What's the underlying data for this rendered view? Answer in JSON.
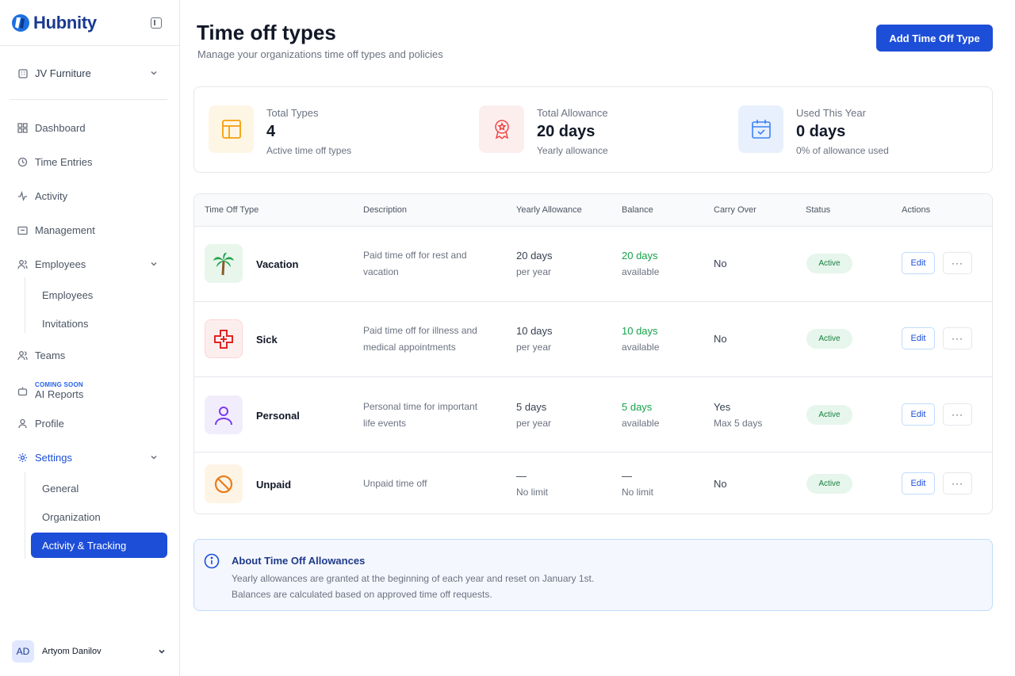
{
  "app": {
    "name": "Hubnity"
  },
  "sidebar": {
    "org": "JV Furniture",
    "items": [
      {
        "label": "Dashboard"
      },
      {
        "label": "Time Entries"
      },
      {
        "label": "Activity"
      },
      {
        "label": "Management"
      },
      {
        "label": "Employees",
        "children": [
          {
            "label": "Employees"
          },
          {
            "label": "Invitations"
          }
        ]
      },
      {
        "label": "Teams"
      },
      {
        "label": "AI Reports",
        "badge": "COMING SOON"
      },
      {
        "label": "Profile"
      },
      {
        "label": "Settings",
        "children": [
          {
            "label": "General"
          },
          {
            "label": "Organization"
          },
          {
            "label": "Activity & Tracking",
            "active": true
          }
        ]
      }
    ],
    "user": {
      "initials": "AD",
      "name": "Artyom Danilov"
    }
  },
  "header": {
    "title": "Time off types",
    "subtitle": "Manage your organizations time off types and policies",
    "add_button": "Add Time Off Type"
  },
  "stats": [
    {
      "label": "Total Types",
      "value": "4",
      "desc": "Active time off types",
      "icon": "layout-icon",
      "color": "#f59e0b"
    },
    {
      "label": "Total Allowance",
      "value": "20 days",
      "desc": "Yearly allowance",
      "icon": "award-icon",
      "color": "#ef4444"
    },
    {
      "label": "Used This Year",
      "value": "0 days",
      "desc": "0% of allowance used",
      "icon": "calendar-check-icon",
      "color": "#3b82f6"
    }
  ],
  "table": {
    "columns": [
      "Time Off Type",
      "Description",
      "Yearly Allowance",
      "Balance",
      "Carry Over",
      "Status",
      "Actions"
    ],
    "edit_label": "Edit",
    "more_label": "···",
    "rows": [
      {
        "name": "Vacation",
        "icon": "palm-tree-icon",
        "desc_line1": "Paid time off for rest and",
        "desc_line2": "vacation",
        "allowance": "20 days",
        "allowance_unit": "per year",
        "balance": "20 days",
        "balance_unit": "available",
        "carry": "No",
        "carry_sub": "",
        "status": "Active"
      },
      {
        "name": "Sick",
        "icon": "medical-cross-icon",
        "desc_line1": "Paid time off for illness and",
        "desc_line2": "medical appointments",
        "allowance": "10 days",
        "allowance_unit": "per year",
        "balance": "10 days",
        "balance_unit": "available",
        "carry": "No",
        "carry_sub": "",
        "status": "Active"
      },
      {
        "name": "Personal",
        "icon": "person-icon",
        "desc_line1": "Personal time for important",
        "desc_line2": "life events",
        "allowance": "5 days",
        "allowance_unit": "per year",
        "balance": "5 days",
        "balance_unit": "available",
        "carry": "Yes",
        "carry_sub": "Max 5 days",
        "status": "Active"
      },
      {
        "name": "Unpaid",
        "icon": "prohibited-icon",
        "desc_line1": "Unpaid time off",
        "desc_line2": "",
        "allowance": "—",
        "allowance_unit": "No limit",
        "balance": "—",
        "balance_unit": "No limit",
        "carry": "No",
        "carry_sub": "",
        "status": "Active"
      }
    ]
  },
  "info": {
    "title": "About Time Off Allowances",
    "line1": "Yearly allowances are granted at the beginning of each year and reset on January 1st.",
    "line2": "Balances are calculated based on approved time off requests."
  }
}
